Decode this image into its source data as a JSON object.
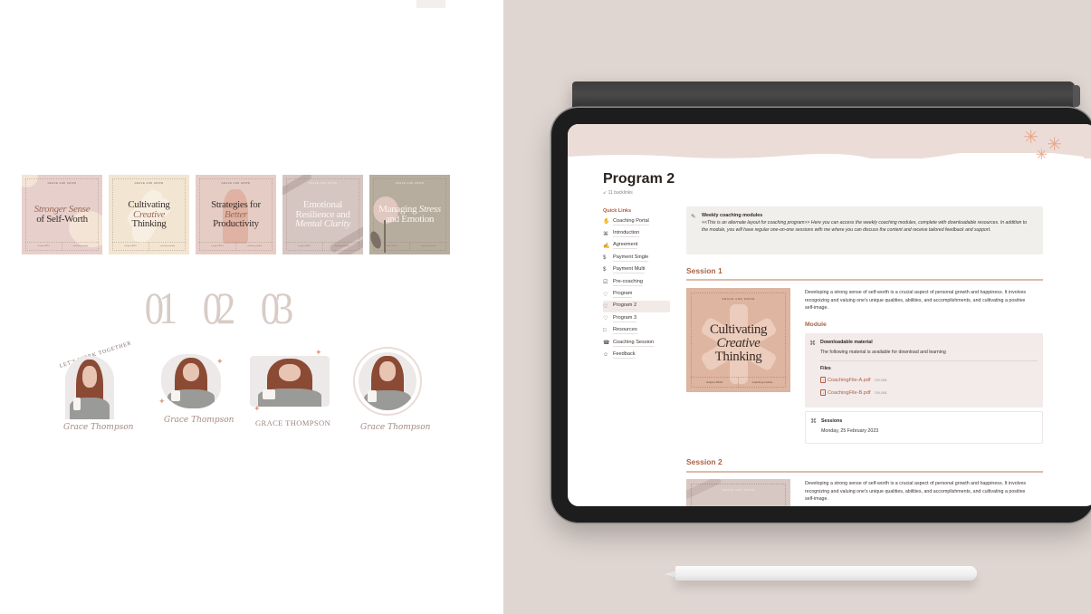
{
  "left": {
    "covers": [
      {
        "brand": "GRACE AND GROW",
        "title_italic": "Stronger Sense",
        "title_rest": "of Self-Worth",
        "foot_left": "chapter 08/10",
        "foot_right": "coaching module"
      },
      {
        "brand": "GRACE AND GROW",
        "title_top": "Cultivating",
        "title_italic": "Creative",
        "title_rest": "Thinking",
        "foot_left": "chapter 08/10",
        "foot_right": "coaching module"
      },
      {
        "brand": "GRACE AND GROW",
        "title_top": "Strategies for",
        "title_italic": "Better",
        "title_rest": "Productivity",
        "foot_left": "chapter 08/10",
        "foot_right": "coaching module"
      },
      {
        "brand": "GRACE AND GROW",
        "title_top": "Emotional",
        "title_mid": "Resilience and",
        "title_italic": "Mental Clarity",
        "foot_left": "chapter 08/10",
        "foot_right": "coaching module"
      },
      {
        "brand": "GRACE AND GROW",
        "title_top": "Managing",
        "title_italic": "Stress",
        "title_rest": "and Emotion",
        "foot_left": "chapter 08/10",
        "foot_right": "coaching module"
      }
    ],
    "numbers": [
      "01",
      "02",
      "03"
    ],
    "profiles": {
      "arch_text": "LET'S WORK TOGETHER",
      "signature": "Grace Thompson",
      "caps_name": "GRACE THOMPSON"
    }
  },
  "notion": {
    "page_title": "Program 2",
    "backlinks": "11 backlinks",
    "quick_links": {
      "heading": "Quick Links",
      "items": [
        {
          "icon": "handshake-icon",
          "glyph": "✋",
          "label": "Coaching Portal"
        },
        {
          "icon": "command-icon",
          "glyph": "⌘",
          "label": "Introduction"
        },
        {
          "icon": "signature-icon",
          "glyph": "✍",
          "label": "Agreement"
        },
        {
          "icon": "dollar-icon",
          "glyph": "$",
          "label": "Payment Single"
        },
        {
          "icon": "dollar-icon",
          "glyph": "$",
          "label": "Payment Multi"
        },
        {
          "icon": "checkbox-icon",
          "glyph": "☑",
          "label": "Pre-coaching"
        },
        {
          "icon": "heart-chat-icon",
          "glyph": "♡",
          "label": "Program"
        },
        {
          "icon": "heart-chat-icon",
          "glyph": "♡",
          "label": "Program 2",
          "active": true
        },
        {
          "icon": "heart-chat-icon",
          "glyph": "♡",
          "label": "Program 3"
        },
        {
          "icon": "document-icon",
          "glyph": "□",
          "label": "Resources"
        },
        {
          "icon": "phone-icon",
          "glyph": "☎",
          "label": "Coaching Session"
        },
        {
          "icon": "feedback-icon",
          "glyph": "☺",
          "label": "Feedback"
        }
      ]
    },
    "callout": {
      "icon": "magic-wand-icon",
      "title": "Weekly coaching modules",
      "body": "<<This is an alternate layout for coaching program>> Here you can access the weekly coaching modules, complete with downloadable resources. In addition to the module, you will have regular one-on-one sessions with me where you can discuss the content and receive tailored feedback and support."
    },
    "session1": {
      "heading": "Session 1",
      "thumb": {
        "brand": "GRACE AND GROW",
        "title_top": "Cultivating",
        "title_italic": "Creative",
        "title_rest": "Thinking",
        "foot_left": "chapter 08/10",
        "foot_right": "coaching module"
      },
      "description": "Developing a strong sense of self-worth is a crucial aspect of personal growth and happiness. It involves recognizing and valuing one's unique qualities, abilities, and accomplishments, and cultivating a positive self-image.",
      "module_heading": "Module",
      "module": {
        "title": "Downloadable material",
        "subtitle": "The following material is available for download and learning",
        "files_heading": "Files",
        "files": [
          {
            "name": "CoachingFile-A.pdf",
            "size": "749.2KB"
          },
          {
            "name": "CoachingFile-B.pdf",
            "size": "749.2KB"
          }
        ]
      },
      "sessions": {
        "title": "Sessions",
        "date": "Monday, 25 February 2023"
      }
    },
    "session2": {
      "heading": "Session 2",
      "thumb_brand": "GRACE AND GROW",
      "description": "Developing a strong sense of self-worth is a crucial aspect of personal growth and happiness. It involves recognizing and valuing one's unique qualities, abilities, and accomplishments, and cultivating a positive self-image."
    }
  },
  "colors": {
    "accent": "#a96346",
    "background_right": "#e0d6d1",
    "banner": "#ecdcd8"
  }
}
